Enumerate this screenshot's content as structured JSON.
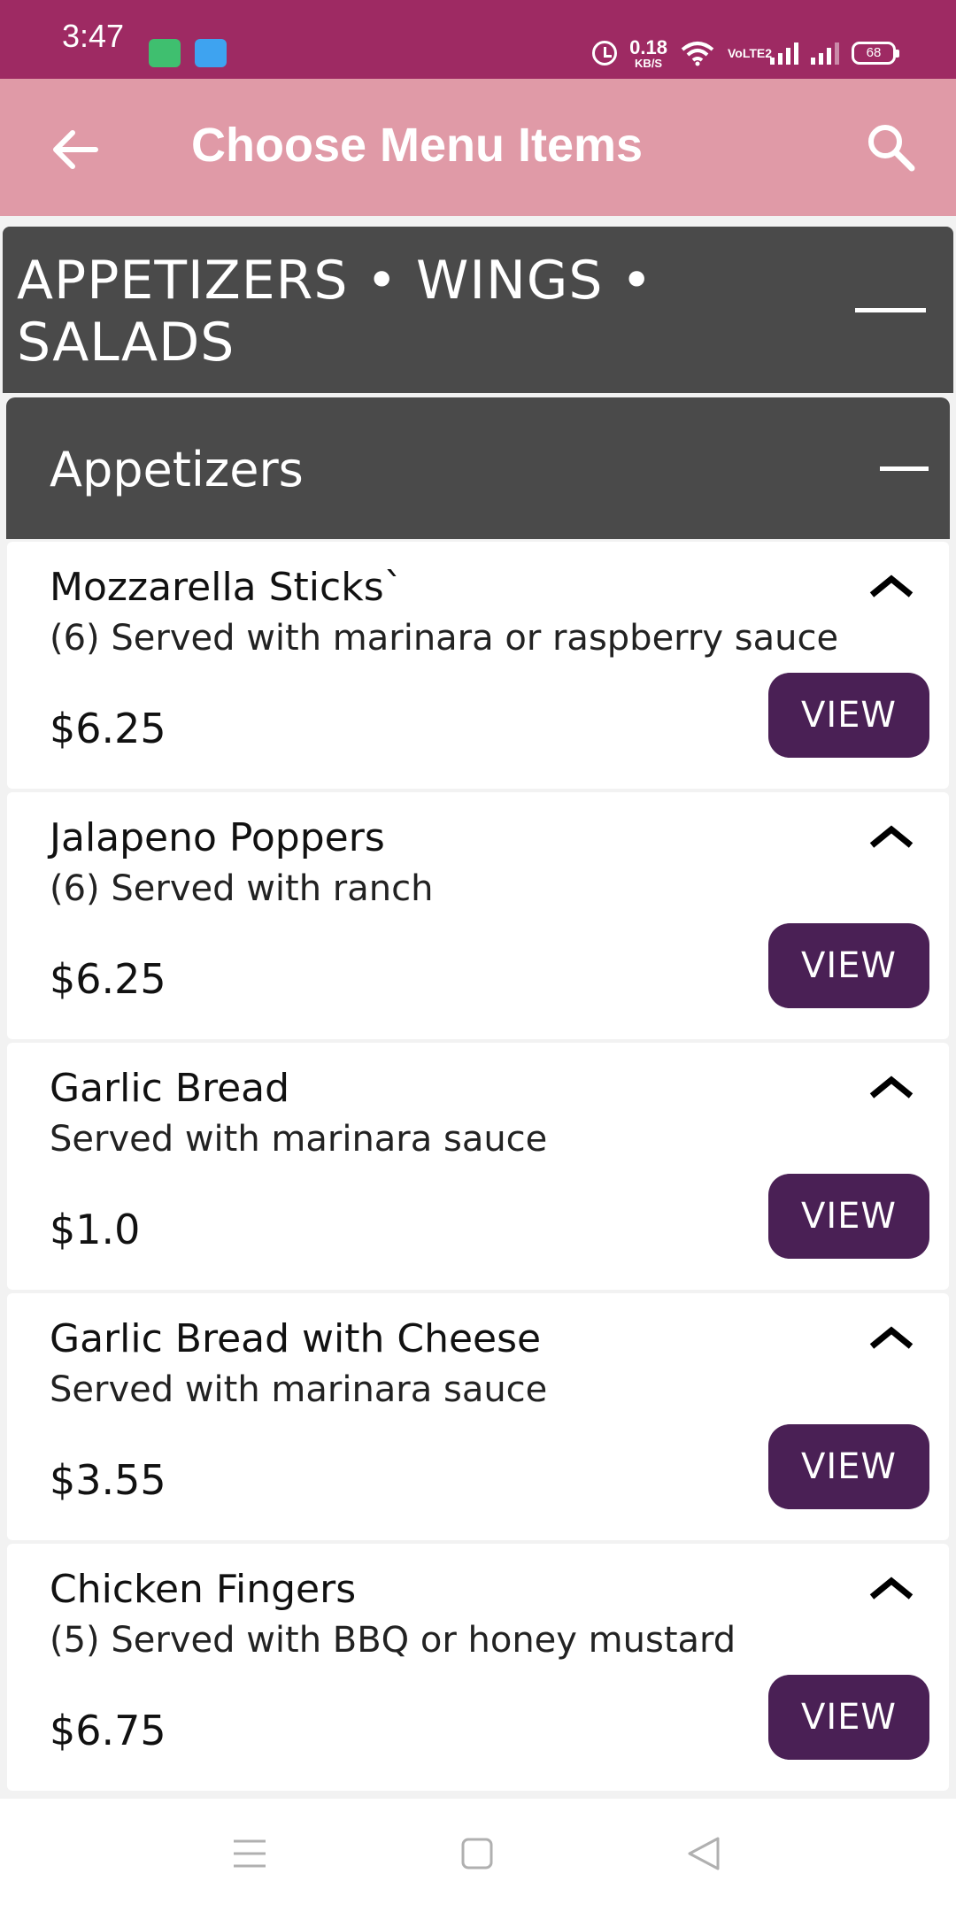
{
  "status_bar": {
    "time": "3:47",
    "net_speed": "0.18",
    "net_unit": "KB/S",
    "lte_label": "VoLTE2",
    "battery": "68"
  },
  "app_bar": {
    "title": "Choose Menu Items",
    "back_icon": "arrow-left-icon",
    "search_icon": "search-icon"
  },
  "category": {
    "title": "APPETIZERS • WINGS • SALADS"
  },
  "section": {
    "title": "Appetizers"
  },
  "items": [
    {
      "name": "Mozzarella Sticks`",
      "description": "(6) Served with marinara or raspberry sauce",
      "price": "$6.25",
      "button": "VIEW"
    },
    {
      "name": "Jalapeno Poppers",
      "description": "(6) Served with ranch",
      "price": "$6.25",
      "button": "VIEW"
    },
    {
      "name": "Garlic Bread",
      "description": "Served with marinara sauce",
      "price": "$1.0",
      "button": "VIEW"
    },
    {
      "name": "Garlic Bread with Cheese",
      "description": "Served with marinara sauce",
      "price": "$3.55",
      "button": "VIEW"
    },
    {
      "name": "Chicken Fingers",
      "description": "(5) Served with BBQ or honey mustard",
      "price": "$6.75",
      "button": "VIEW"
    }
  ],
  "colors": {
    "status_bar": "#9e2a63",
    "app_bar": "#e09aa7",
    "header_bg": "#4a4a4a",
    "button_bg": "#4a2055"
  }
}
